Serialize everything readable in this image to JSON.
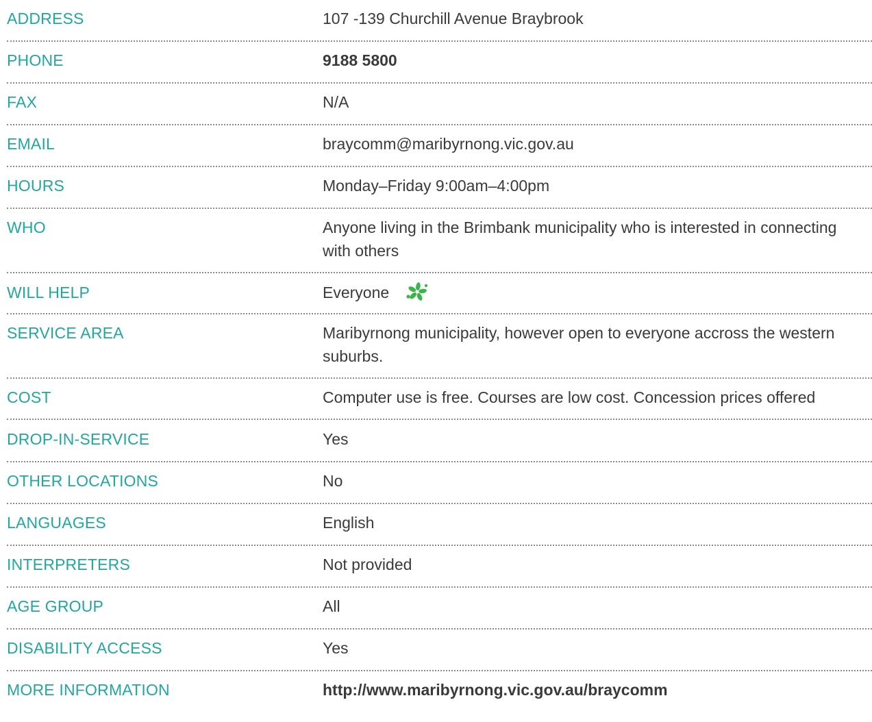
{
  "rows": [
    {
      "label": "ADDRESS",
      "value": "107 -139 Churchill Avenue Braybrook"
    },
    {
      "label": "PHONE",
      "value": "9188 5800"
    },
    {
      "label": "FAX",
      "value": "N/A"
    },
    {
      "label": "EMAIL",
      "value": "braycomm@maribyrnong.vic.gov.au"
    },
    {
      "label": "HOURS",
      "value": "Monday–Friday 9:00am–4:00pm"
    },
    {
      "label": "WHO",
      "value": "Anyone living in the Brimbank municipality who is interested in connecting with others"
    },
    {
      "label": "WILL HELP",
      "value": "Everyone"
    },
    {
      "label": "SERVICE AREA",
      "value": "Maribyrnong municipality, however open to everyone accross the western suburbs."
    },
    {
      "label": "COST",
      "value": "Computer use is free. Courses are low cost. Concession prices offered"
    },
    {
      "label": "DROP-IN-SERVICE",
      "value": "Yes"
    },
    {
      "label": "OTHER LOCATIONS",
      "value": "No"
    },
    {
      "label": "LANGUAGES",
      "value": "English"
    },
    {
      "label": "INTERPRETERS",
      "value": "Not provided"
    },
    {
      "label": "AGE GROUP",
      "value": "All"
    },
    {
      "label": "DISABILITY ACCESS",
      "value": "Yes"
    },
    {
      "label": "MORE INFORMATION",
      "value": "http://www.maribyrnong.vic.gov.au/braycomm"
    }
  ],
  "icons": {
    "will_help": "flower-icon"
  },
  "colors": {
    "label": "#22a6a0",
    "value": "#3a3a3a",
    "icon": "#39b54a",
    "divider": "#8a8a8a"
  }
}
